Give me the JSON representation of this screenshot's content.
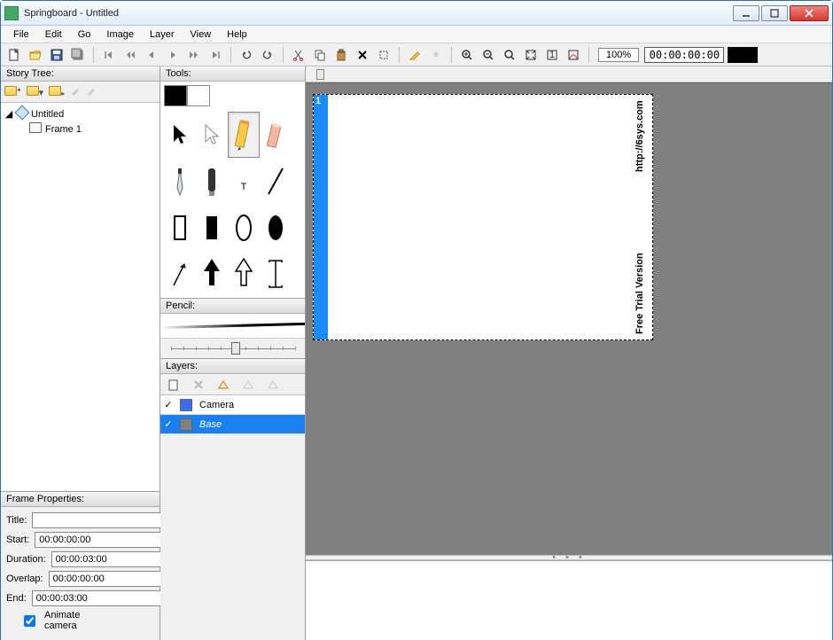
{
  "window": {
    "title": "Springboard - Untitled"
  },
  "menu": [
    "File",
    "Edit",
    "Go",
    "Image",
    "Layer",
    "View",
    "Help"
  ],
  "toolbar": {
    "zoom": "100%",
    "timecode": "00:00:00:00"
  },
  "storytree": {
    "header": "Story Tree:",
    "root": "Untitled",
    "child": "Frame 1"
  },
  "frameprops": {
    "header": "Frame Properties:",
    "labels": {
      "title": "Title:",
      "start": "Start:",
      "duration": "Duration:",
      "overlap": "Overlap:",
      "end": "End:",
      "animate": "Animate camera"
    },
    "values": {
      "title": "",
      "start": "00:00:00:00",
      "duration": "00:00:03:00",
      "overlap": "00:00:00:00",
      "end": "00:00:03:00"
    },
    "animate_checked": true
  },
  "tools": {
    "header": "Tools:",
    "fg": "#000000",
    "bg": "#ffffff",
    "selected": "pencil"
  },
  "pencil": {
    "header": "Pencil:"
  },
  "layers": {
    "header": "Layers:",
    "items": [
      {
        "name": "Camera",
        "color": "#3a6cff",
        "visible": true,
        "selected": false
      },
      {
        "name": "Base",
        "color": "#808080",
        "visible": true,
        "selected": true
      }
    ]
  },
  "canvas": {
    "frame_number": "1",
    "watermark_top": "http://6sys.com",
    "watermark_bottom": "Free Trial Version"
  }
}
